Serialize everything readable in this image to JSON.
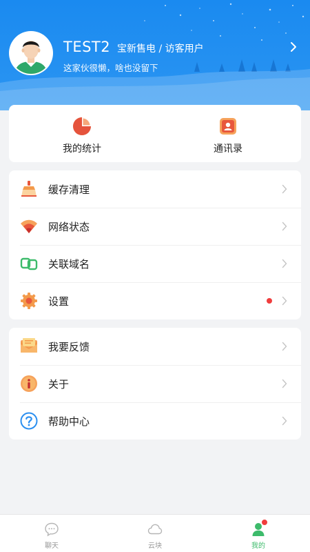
{
  "profile": {
    "name": "TEST2",
    "org": "宝新售电 / 访客用户",
    "signature": "这家伙很懒，啥也没留下"
  },
  "stats": [
    {
      "label": "我的统计",
      "icon": "pie-chart-icon"
    },
    {
      "label": "通讯录",
      "icon": "contacts-icon"
    }
  ],
  "menu_group_1": [
    {
      "label": "缓存清理",
      "icon": "broom-icon"
    },
    {
      "label": "网络状态",
      "icon": "wifi-icon"
    },
    {
      "label": "关联域名",
      "icon": "link-icon"
    },
    {
      "label": "设置",
      "icon": "gear-icon",
      "badge": true
    }
  ],
  "menu_group_2": [
    {
      "label": "我要反馈",
      "icon": "envelope-icon"
    },
    {
      "label": "关于",
      "icon": "info-icon"
    },
    {
      "label": "帮助中心",
      "icon": "help-icon"
    }
  ],
  "tabbar": [
    {
      "label": "聊天",
      "icon": "chat-icon",
      "active": false
    },
    {
      "label": "云块",
      "icon": "cloud-icon",
      "active": false
    },
    {
      "label": "我的",
      "icon": "user-icon",
      "active": true,
      "badge": true
    }
  ],
  "colors": {
    "header_blue": "#1a8af0",
    "accent_green": "#3dbb6b",
    "badge_red": "#f03d3d"
  }
}
